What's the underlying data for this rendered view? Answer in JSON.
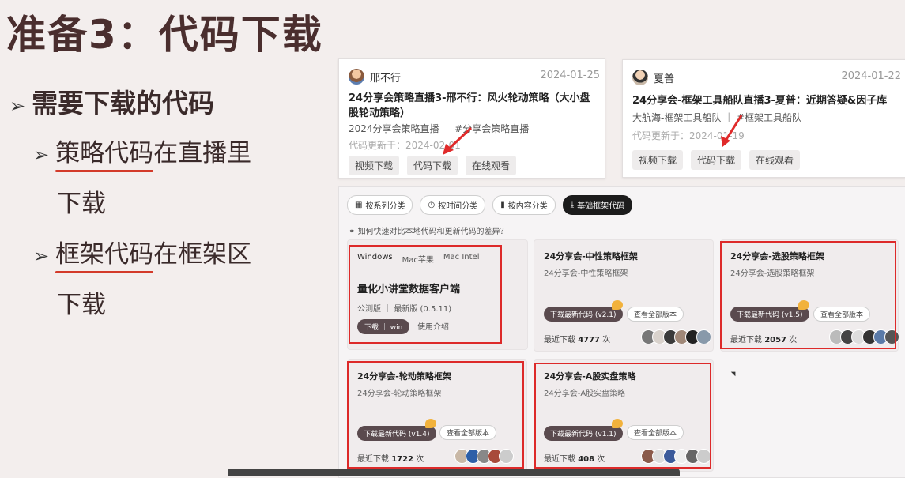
{
  "slide": {
    "title": "准备3：代码下载",
    "bullet1": "需要下载的代码",
    "bullet2_underlined": "策略代码",
    "bullet2_rest": "在直播里",
    "bullet2_line2": "下载",
    "bullet3_underlined": "框架代码",
    "bullet3_rest": "在框架区",
    "bullet3_line2": "下载",
    "arrow_glyph": "➢"
  },
  "card1": {
    "author": "邢不行",
    "date": "2024-01-25",
    "title": "24分享会策略直播3-邢不行：风火轮动策略（大小盘股轮动策略）",
    "tags": "2024分享会策略直播 ｜ #分享会策略直播",
    "updated": "代码更新于：2024-02-01",
    "btn_video": "视频下载",
    "btn_code": "代码下载",
    "btn_online": "在线观看"
  },
  "card2": {
    "author": "夏普",
    "date": "2024-01-22",
    "title": "24分享会-框架工具船队直播3-夏普：近期答疑&因子库",
    "tags": "大航海-框架工具船队 ｜ #框架工具船队",
    "updated": "代码更新于：2024-01-19",
    "btn_video": "视频下载",
    "btn_code": "代码下载",
    "btn_online": "在线观看"
  },
  "filters": {
    "series": "按系列分类",
    "time": "按时间分类",
    "content": "按内容分类",
    "base": "基础框架代码"
  },
  "hint": "如何快速对比本地代码和更新代码的差异？",
  "client": {
    "tab_windows": "Windows",
    "tab_mac_arm": "Mac苹果",
    "tab_mac_intel": "Mac Intel",
    "title": "量化小讲堂数据客户端",
    "version": "公测版 ｜ 最新版 (0.5.11)",
    "download": "下载 ｜ win",
    "help": "使用介绍"
  },
  "frameworks": {
    "neutral": {
      "title": "24分享会-中性策略框架",
      "desc": "24分享会-中性策略框架",
      "download": "下载最新代码 (v2.1)",
      "view_all": "查看全部版本",
      "recent_prefix": "最近下载",
      "recent_count": "4777",
      "recent_suffix": "次"
    },
    "stock": {
      "title": "24分享会-选股策略框架",
      "desc": "24分享会-选股策略框架",
      "download": "下载最新代码 (v1.5)",
      "view_all": "查看全部版本",
      "recent_prefix": "最近下载",
      "recent_count": "2057",
      "recent_suffix": "次"
    },
    "rotation": {
      "title": "24分享会-轮动策略框架",
      "desc": "24分享会-轮动策略框架",
      "download": "下载最新代码 (v1.4)",
      "view_all": "查看全部版本",
      "recent_prefix": "最近下载",
      "recent_count": "1722",
      "recent_suffix": "次"
    },
    "ashare": {
      "title": "24分享会-A股实盘策略",
      "desc": "24分享会-A股实盘策略",
      "download": "下载最新代码 (v1.1)",
      "view_all": "查看全部版本",
      "recent_prefix": "最近下载",
      "recent_count": "408",
      "recent_suffix": "次"
    }
  },
  "colors": {
    "highlight_red": "#dd2a2a",
    "title_brown": "#4a2e2e",
    "dark_button": "#5a4a4e",
    "badge_orange": "#f2b23c"
  }
}
